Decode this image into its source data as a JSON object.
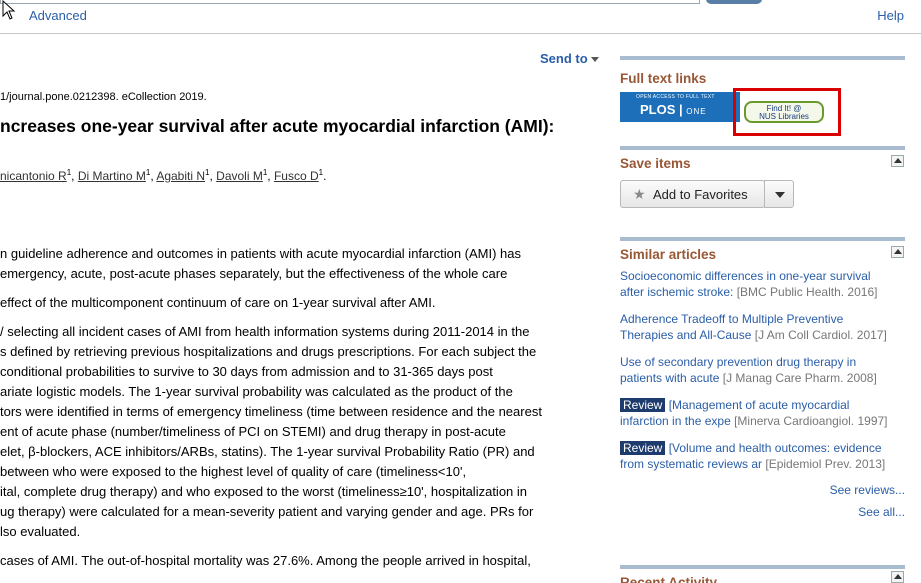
{
  "topbar": {
    "advanced_label": "Advanced",
    "help_label": "Help"
  },
  "article": {
    "send_to_label": "Send to",
    "citation": "1/journal.pone.0212398. eCollection 2019.",
    "title": "ncreases one-year survival after acute myocardial infarction (AMI):",
    "authors": [
      {
        "name": "nicantonio R",
        "sup": "1",
        "sep": ", "
      },
      {
        "name": "Di Martino M",
        "sup": "1",
        "sep": ", "
      },
      {
        "name": "Agabiti N",
        "sup": "1",
        "sep": ", "
      },
      {
        "name": "Davoli M",
        "sup": "1",
        "sep": ", "
      },
      {
        "name": "Fusco D",
        "sup": "1",
        "sep": "."
      }
    ],
    "paragraphs": [
      [
        "n guideline adherence and outcomes in patients with acute myocardial infarction (AMI) has",
        " emergency, acute, post-acute phases separately, but the effectiveness of the whole care"
      ],
      [
        "effect of the multicomponent continuum of care on 1-year survival after AMI."
      ],
      [
        "/ selecting all incident cases of AMI from health information systems during 2011-2014 in the",
        "s defined by retrieving previous hospitalizations and drugs prescriptions. For each subject the",
        "conditional probabilities to survive to 30 days from admission and to 31-365 days post",
        "ariate logistic models. The 1-year survival probability was calculated as the product of the",
        "tors were identified in terms of emergency timeliness (time between residence and the nearest",
        "ent of acute phase (number/timeliness of PCI on STEMI) and drug therapy in post-acute",
        "elet, β-blockers, ACE inhibitors/ARBs, statins). The 1-year survival Probability Ratio (PR) and",
        "between who were exposed to the highest level of quality of care (timeliness<10',",
        "ital, complete drug therapy) and who exposed to the worst (timeliness≥10', hospitalization in",
        "ug therapy) were calculated for a mean-severity patient and varying gender and age. PRs for",
        "lso evaluated."
      ],
      [
        "cases of AMI. The out-of-hospital mortality was 27.6%. Among the people arrived in hospital,"
      ]
    ]
  },
  "sidebar": {
    "full_text_title": "Full text links",
    "plos_small": "OPEN ACCESS TO FULL TEXT",
    "plos_logo": "PLOS",
    "plos_logo_suffix": "ONE",
    "findit_line1": "Find It! @",
    "findit_line2": "NUS Libraries",
    "save_title": "Save items",
    "add_favorites_label": "Add to Favorites",
    "similar_title": "Similar articles",
    "similar_items": [
      {
        "badge": "",
        "line1": "Socioeconomic differences in one-year survival",
        "line2": "after ischemic stroke:",
        "meta": " [BMC Public Health. 2016]"
      },
      {
        "badge": "",
        "line1": "Adherence Tradeoff to Multiple Preventive",
        "line2": "Therapies and All-Cause",
        "meta": " [J Am Coll Cardiol. 2017]"
      },
      {
        "badge": "",
        "line1": "Use of secondary prevention drug therapy in",
        "line2": "patients with acute",
        "meta": " [J Manag Care Pharm. 2008]"
      },
      {
        "badge": "Review",
        "line1": " [Management of acute myocardial",
        "line2": "infarction in the expe",
        "meta": " [Minerva Cardioangiol. 1997]"
      },
      {
        "badge": "Review",
        "line1": " [Volume and health outcomes: evidence",
        "line2": "from systematic reviews ar",
        "meta": " [Epidemiol Prev. 2013]"
      }
    ],
    "see_reviews_label": "See reviews...",
    "see_all_label": "See all...",
    "recent_activity_title": "Recent Activity"
  }
}
